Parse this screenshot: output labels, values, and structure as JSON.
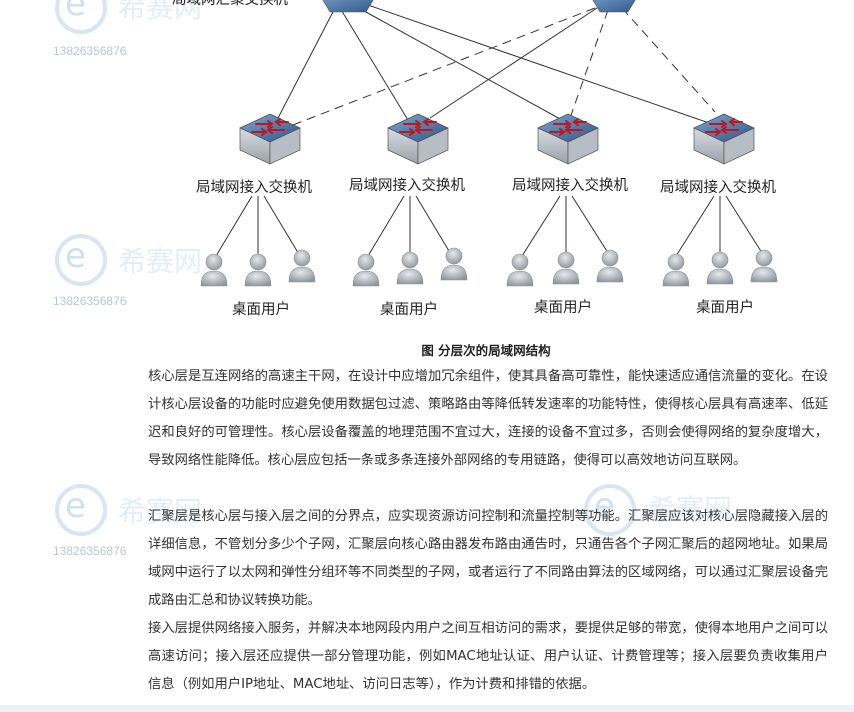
{
  "watermark": {
    "phone": "13826356876",
    "brand": "希赛网"
  },
  "diagram": {
    "top_label": "局域网汇聚交换机",
    "access_switch_labels": [
      "局域网接入交换机",
      "局域网接入交换机",
      "局域网接入交换机",
      "局域网接入交换机"
    ],
    "user_group_labels": [
      "桌面用户",
      "桌面用户",
      "桌面用户",
      "桌面用户"
    ],
    "caption": "图  分层次的局域网结构"
  },
  "article": {
    "paragraphs": [
      "核心层是互连网络的高速主干网，在设计中应增加冗余组件，使其具备高可靠性，能快速适应通信流量的变化。在设计核心层设备的功能时应避免使用数据包过滤、策略路由等降低转发速率的功能特性，使得核心层具有高速率、低延迟和良好的可管理性。核心层设备覆盖的地理范围不宜过大，连接的设备不宜过多，否则会使得网络的复杂度增大，导致网络性能降低。核心层应包括一条或多条连接外部网络的专用链路，使得可以高效地访问互联网。",
      "汇聚层是核心层与接入层之间的分界点，应实现资源访问控制和流量控制等功能。汇聚层应该对核心层隐藏接入层的详细信息，不管划分多少个子网，汇聚层向核心路由器发布路由通告时，只通告各个子网汇聚后的超网地址。如果局域网中运行了以太网和弹性分组环等不同类型的子网，或者运行了不同路由算法的区域网络，可以通过汇聚层设备完成路由汇总和协议转换功能。",
      "接入层提供网络接入服务，并解决本地网段内用户之间互相访问的需求，要提供足够的带宽，使得本地用户之间可以高速访问；接入层还应提供一部分管理功能，例如MAC地址认证、用户认证、计费管理等；接入层要负责收集用户信息（例如用户IP地址、MAC地址、访问日志等），作为计费和排错的依据。"
    ]
  }
}
